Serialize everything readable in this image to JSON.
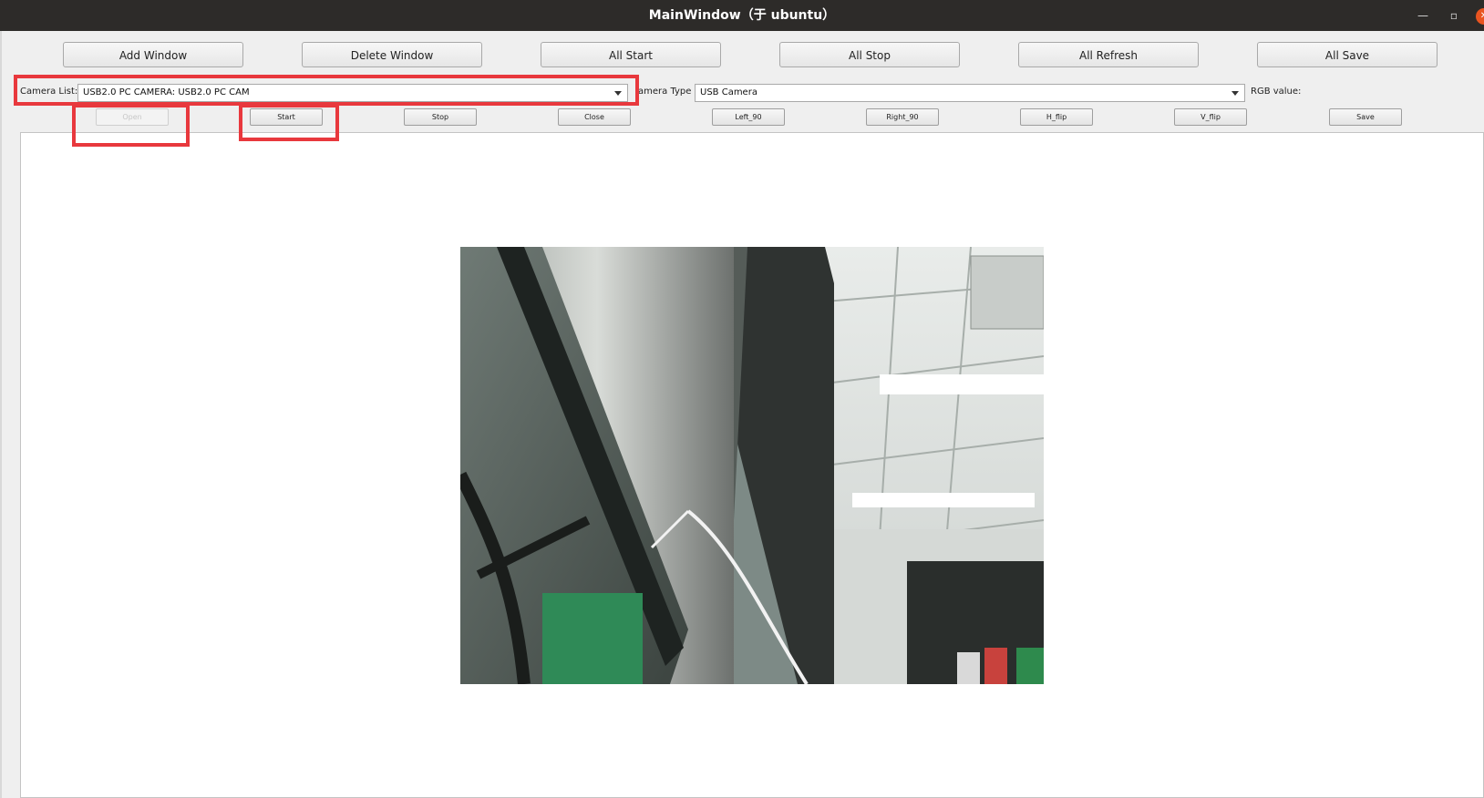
{
  "window": {
    "title": "MainWindow（于 ubuntu）",
    "minimize_icon": "minimize-icon",
    "maximize_icon": "maximize-icon",
    "close_icon": "close-icon"
  },
  "toolbar": {
    "buttons": [
      "Add Window",
      "Delete Window",
      "All Start",
      "All Stop",
      "All Refresh",
      "All Save"
    ]
  },
  "camera_row": {
    "camera_list_label": "Camera List:",
    "camera_list_value": "USB2.0 PC CAMERA: USB2.0 PC CAM",
    "camera_type_label": "amera Type",
    "camera_type_value": "USB Camera",
    "rgb_label": "RGB value:"
  },
  "controls": {
    "buttons": [
      "Open",
      "Start",
      "Stop",
      "Close",
      "Left_90",
      "Right_90",
      "H_flip",
      "V_flip",
      "Save"
    ],
    "open_enabled": false
  },
  "preview": {
    "content": "camera-feed-image"
  },
  "colors": {
    "titlebar": "#2d2b29",
    "highlight": "#e8383d",
    "close_button": "#e95420"
  }
}
